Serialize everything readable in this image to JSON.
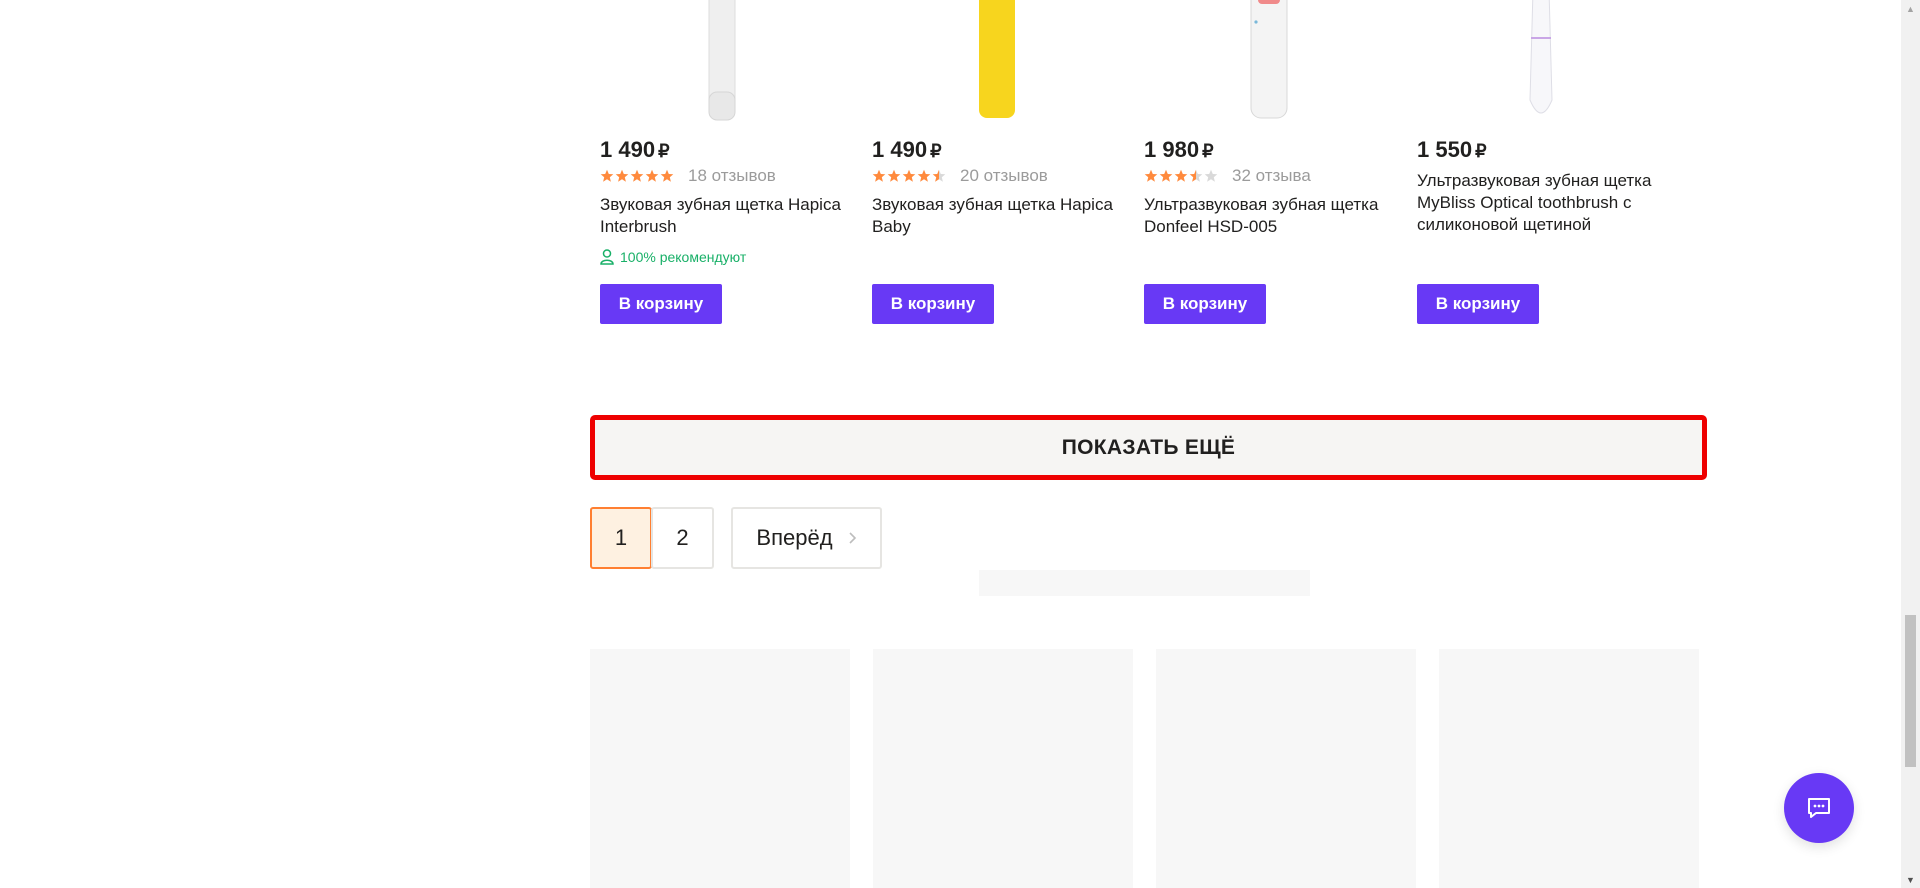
{
  "currency": "₽",
  "products": [
    {
      "price": "1 490",
      "rating_stars": 5,
      "reviews": "18 отзывов",
      "title": "Звуковая зубная щетка Hapica Interbrush",
      "recommend": "100% рекомендуют",
      "cart_label": "В корзину",
      "brush_color": "#efefef"
    },
    {
      "price": "1 490",
      "rating_stars": 4.5,
      "reviews": "20 отзывов",
      "title": "Звуковая зубная щетка Hapica Baby",
      "cart_label": "В корзину",
      "brush_color": "#f7d51e"
    },
    {
      "price": "1 980",
      "rating_stars": 3.5,
      "reviews": "32 отзыва",
      "title": "Ультразвуковая зубная щетка Donfeel HSD-005",
      "cart_label": "В корзину",
      "brush_color": "#f2f2f2"
    },
    {
      "price": "1 550",
      "rating_stars": null,
      "reviews": "",
      "title": "Ультразвуковая зубная щетка MyBliss Optical toothbrush с силиконовой щетиной",
      "cart_label": "В корзину",
      "brush_color": "#f5f5f8"
    }
  ],
  "show_more_label": "ПОКАЗАТЬ ЕЩЁ",
  "pagination": {
    "pages": [
      "1",
      "2"
    ],
    "current": "1",
    "next_label": "Вперёд"
  },
  "colors": {
    "accent": "#6839f5",
    "star": "#ff8a3d",
    "star_empty": "#d9d9d9",
    "recommend": "#19b068",
    "highlight_border": "#ee0000",
    "active_page_border": "#ff7f31"
  },
  "icons": {
    "chat": "chat-bubble-icon",
    "recommend": "person-icon",
    "next": "chevron-right-icon"
  }
}
